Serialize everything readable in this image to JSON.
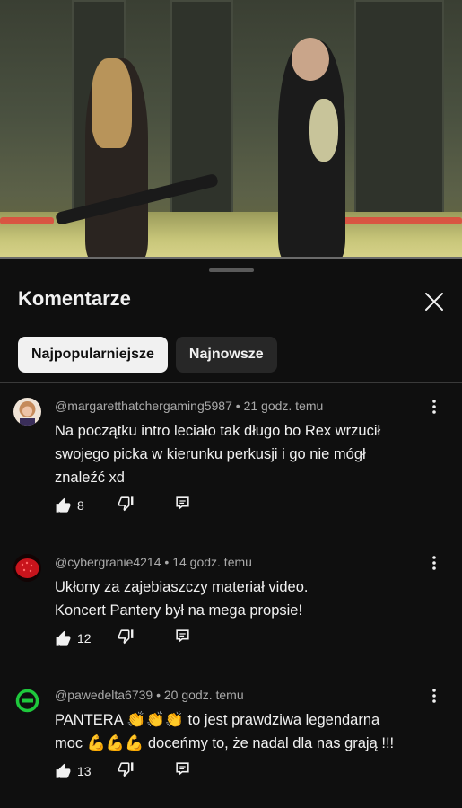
{
  "sheet": {
    "title": "Komentarze",
    "filters": [
      {
        "label": "Najpopularniejsze",
        "active": true
      },
      {
        "label": "Najnowsze",
        "active": false
      }
    ]
  },
  "comments": [
    {
      "author": "@margaretthatchergaming5987",
      "time": "21 godz. temu",
      "lines": [
        "Na początku intro leciało tak długo bo Rex wrzucił",
        "swojego picka w kierunku perkusji i go nie mógł",
        "znaleźć xd"
      ],
      "likes": "8"
    },
    {
      "author": "@cybergranie4214",
      "time": "14 godz. temu",
      "lines": [
        "Ukłony za zajebiaszczy materiał video.",
        "Koncert Pantery był na mega propsie!"
      ],
      "likes": "12"
    },
    {
      "author": "@pawedelta6739",
      "time": "20 godz. temu",
      "line1_a": "PANTERA ",
      "line1_emoji": "👏👏👏",
      "line1_b": " to jest prawdziwa legendarna",
      "line2_a": "moc ",
      "line2_emoji": "💪💪💪",
      "line2_b": " doceńmy to, że nadal dla nas grają !!!",
      "likes": "13"
    }
  ],
  "colors": {
    "background": "#0f0f0f",
    "text": "#f1f1f1",
    "secondary_text": "#aaaaaa",
    "chip_active_bg": "#f1f1f1",
    "chip_inactive_bg": "#272727"
  },
  "icons": [
    "close-icon",
    "more-vert-icon",
    "thumb-up-icon",
    "thumb-down-icon",
    "reply-icon"
  ]
}
